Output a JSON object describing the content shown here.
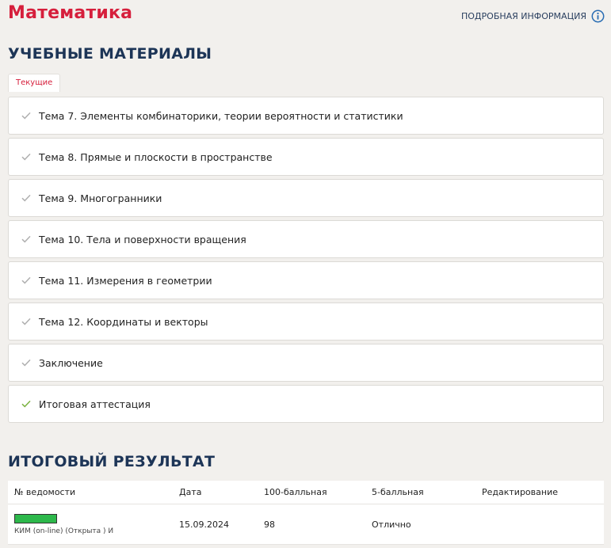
{
  "header": {
    "title": "Математика",
    "info_link": "ПОДРОБНАЯ ИНФОРМАЦИЯ",
    "info_icon": "info-icon"
  },
  "materials": {
    "title": "УЧЕБНЫЕ МАТЕРИАЛЫ",
    "tab": "Текущие",
    "topics": [
      {
        "label": "Тема 7. Элементы комбинаторики, теории вероятности и статистики",
        "check_color": "#b0b0b0"
      },
      {
        "label": "Тема 8. Прямые и плоскости в пространстве",
        "check_color": "#b0b0b0"
      },
      {
        "label": "Тема 9. Многогранники",
        "check_color": "#b0b0b0"
      },
      {
        "label": "Тема 10. Тела и поверхности вращения",
        "check_color": "#b0b0b0"
      },
      {
        "label": "Тема 11. Измерения в геометрии",
        "check_color": "#b0b0b0"
      },
      {
        "label": "Тема 12. Координаты и векторы",
        "check_color": "#b0b0b0"
      },
      {
        "label": "Заключение",
        "check_color": "#b0b0b0"
      },
      {
        "label": "Итоговая аттестация",
        "check_color": "#7cb342"
      }
    ]
  },
  "result": {
    "title": "ИТОГОВЫЙ РЕЗУЛЬТАТ",
    "columns": [
      "№ ведомости",
      "Дата",
      "100-балльная",
      "5-балльная",
      "Редактирование"
    ],
    "rows": [
      {
        "progress": 1.0,
        "kim": "КИМ (on-line) (Открыта ) И",
        "date": "15.09.2024",
        "score100": "98",
        "score5": "Отлично",
        "edit": ""
      }
    ]
  },
  "colors": {
    "accent": "#d61f3c",
    "heading": "#1d3557",
    "progress_fill": "#2db84b"
  }
}
